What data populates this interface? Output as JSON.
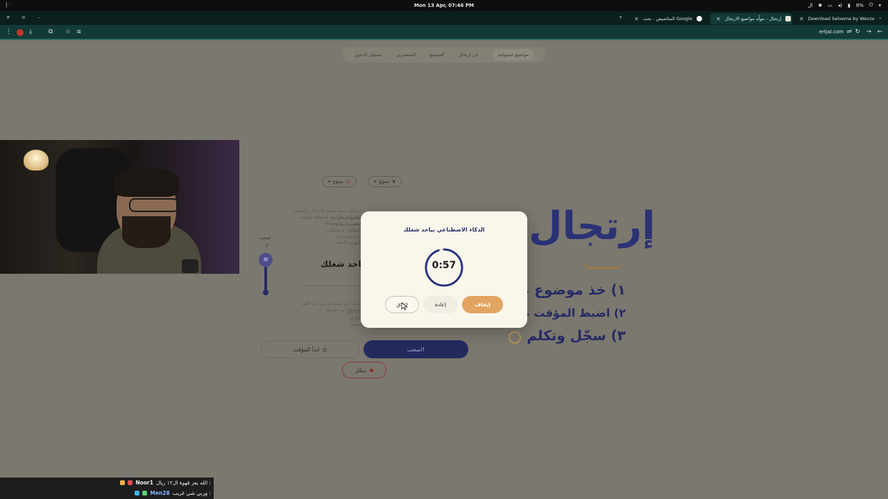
{
  "os_bar": {
    "clock": "Mon 13 Apr, 07:46 PM",
    "battery": "8%",
    "lang": "ال"
  },
  "tabs": [
    {
      "title": "المتاشيش - بحث Google",
      "fav_color": "#ffffff"
    },
    {
      "title": "إرتجال - مولّد مواضيع الارتجال",
      "fav_color": "#e9e4d7",
      "active": true
    },
    {
      "title": "Download Selvema by Wenzel...",
      "fav_color": "#e34b4b"
    }
  ],
  "toolbar": {
    "url": "ertjal.com"
  },
  "page": {
    "nav": [
      "مواضيع عشوائية",
      "عن إرتجال",
      "المجتمع",
      "المتصدرين",
      "تسجيل الدخول"
    ],
    "chips": [
      "متنوّع",
      "متنوّع"
    ],
    "faded_text_1": "إرتجال منصة لتعلم الارتجال والتحدث بثقة عبر مواضيع عشوائية ومؤقت زمني سريع وجماعة",
    "faded_text_2": "تطبيق عملي لتحسين مهارات التواصل استجابات حرة وتقريره اليومي البطاء",
    "heading": "الذكاء الاصطناعي بياخد شغلك",
    "drag_label": "اسحب",
    "faded_text_3": "تحدث عن المشكلة من في اللغة المشكلة في طريقة",
    "faded_text_4": "ركز على أفكارك لتقديم",
    "start_timer": "ابدأ المؤقت",
    "pull": "اسحب!",
    "record": "سجّل",
    "brand": "إرتجال",
    "steps": [
      "١) خذ موضوع عشوائي",
      "٢) اضبط المؤقت على دقيقة",
      "٣) سجّل وتكلم"
    ]
  },
  "chat": [
    {
      "user": "Noor1",
      "message": ": الله يعز قهوة ال١٢ ريال"
    },
    {
      "user": "Men28",
      "message": ": وربي شي غريب"
    }
  ],
  "modal": {
    "title": "الذكاء الاصطناعي بياخد شغلك",
    "time": "0:57",
    "progress": 0.95,
    "close": "إغلاق",
    "reset": "إعادة",
    "stop": "إيقاف"
  },
  "colors": {
    "accent": "#e2a561",
    "primary": "#242a5e",
    "modal_bg": "#f9f6ec"
  }
}
